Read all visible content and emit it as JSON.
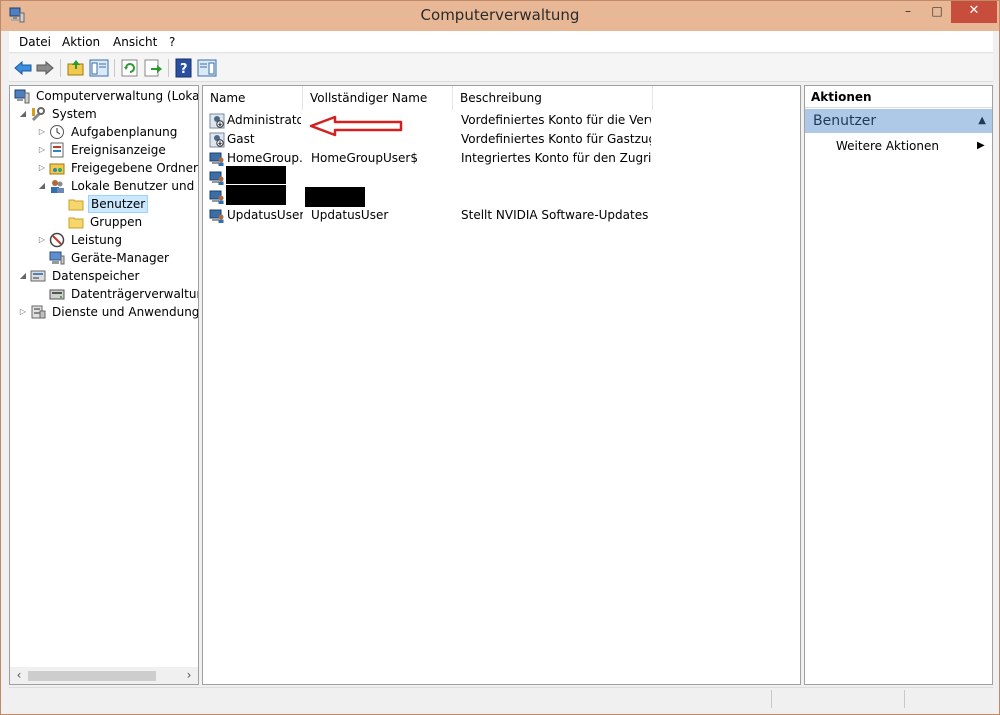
{
  "window": {
    "title": "Computerverwaltung",
    "controls": {
      "minimize": "–",
      "maximize": "□",
      "close": "✕"
    }
  },
  "menu": [
    "Datei",
    "Aktion",
    "Ansicht",
    "?"
  ],
  "tree": {
    "items": [
      {
        "label": "Computerverwaltung (Lokal)",
        "icon": "computer-icon",
        "level": 0,
        "expander": ""
      },
      {
        "label": "System",
        "icon": "tools-icon",
        "level": 1,
        "expander": "◢"
      },
      {
        "label": "Aufgabenplanung",
        "icon": "clock-icon",
        "level": 2,
        "expander": "▷"
      },
      {
        "label": "Ereignisanzeige",
        "icon": "event-viewer-icon",
        "level": 2,
        "expander": "▷"
      },
      {
        "label": "Freigegebene Ordner",
        "icon": "shared-folder-icon",
        "level": 2,
        "expander": "▷"
      },
      {
        "label": "Lokale Benutzer und Gr",
        "icon": "users-icon",
        "level": 2,
        "expander": "◢"
      },
      {
        "label": "Benutzer",
        "icon": "folder-icon",
        "level": 3,
        "expander": "",
        "selected": true
      },
      {
        "label": "Gruppen",
        "icon": "folder-icon",
        "level": 3,
        "expander": ""
      },
      {
        "label": "Leistung",
        "icon": "performance-icon",
        "level": 2,
        "expander": "▷"
      },
      {
        "label": "Geräte-Manager",
        "icon": "device-manager-icon",
        "level": 2,
        "expander": ""
      },
      {
        "label": "Datenspeicher",
        "icon": "storage-icon",
        "level": 1,
        "expander": "◢"
      },
      {
        "label": "Datenträgerverwaltung",
        "icon": "disk-icon",
        "level": 2,
        "expander": ""
      },
      {
        "label": "Dienste und Anwendungen",
        "icon": "services-icon",
        "level": 1,
        "expander": "▷"
      }
    ]
  },
  "list": {
    "columns": [
      "Name",
      "Vollständiger Name",
      "Beschreibung"
    ],
    "rows": [
      {
        "name": "Administrator",
        "fullname": "",
        "description": "Vordefiniertes Konto für die Verw...",
        "icon": "disabled-user-icon"
      },
      {
        "name": "Gast",
        "fullname": "",
        "description": "Vordefiniertes Konto für Gastzugri...",
        "icon": "disabled-user-icon"
      },
      {
        "name": "HomeGroup...",
        "fullname": "HomeGroupUser$",
        "description": "Integriertes Konto für den Zugriff ...",
        "icon": "user-icon"
      },
      {
        "name": "",
        "fullname": "",
        "description": "",
        "icon": "user-icon",
        "redacted_name": true
      },
      {
        "name": "",
        "fullname": "",
        "description": "",
        "icon": "user-icon",
        "redacted_name": true,
        "redacted_fullname": true
      },
      {
        "name": "UpdatusUser",
        "fullname": "UpdatusUser",
        "description": "Stellt NVIDIA Software-Updates b...",
        "icon": "user-icon"
      }
    ],
    "annotation": {
      "type": "red-arrow",
      "points_to": "Administrator",
      "color": "#d42020"
    }
  },
  "actions": {
    "header": "Aktionen",
    "section": "Benutzer",
    "items": [
      {
        "label": "Weitere Aktionen",
        "submenu": "▶"
      }
    ]
  },
  "colors": {
    "titlebar": "#e8b896",
    "close": "#c74d3c",
    "action_section": "#aec9e8",
    "selection": "#cce8ff"
  }
}
